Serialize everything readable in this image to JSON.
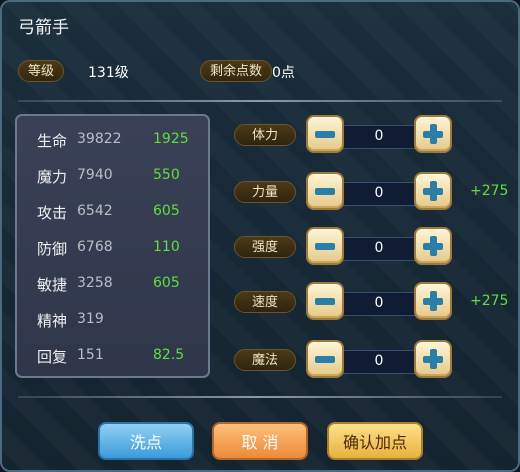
{
  "title": "弓箭手",
  "level": {
    "label": "等级",
    "value": "131级"
  },
  "points": {
    "label": "剩余点数",
    "value": "0点"
  },
  "stats": [
    {
      "name": "生命",
      "value": "39822",
      "bonus": "1925"
    },
    {
      "name": "魔力",
      "value": "7940",
      "bonus": "550"
    },
    {
      "name": "攻击",
      "value": "6542",
      "bonus": "605"
    },
    {
      "name": "防御",
      "value": "6768",
      "bonus": "110"
    },
    {
      "name": "敏捷",
      "value": "3258",
      "bonus": "605"
    },
    {
      "name": "精神",
      "value": "319",
      "bonus": ""
    },
    {
      "name": "回复",
      "value": "151",
      "bonus": "82.5"
    }
  ],
  "allocations": [
    {
      "label": "体力",
      "value": "0",
      "extra": ""
    },
    {
      "label": "力量",
      "value": "0",
      "extra": "+275"
    },
    {
      "label": "强度",
      "value": "0",
      "extra": ""
    },
    {
      "label": "速度",
      "value": "0",
      "extra": "+275"
    },
    {
      "label": "魔法",
      "value": "0",
      "extra": ""
    }
  ],
  "buttons": {
    "reset": "洗点",
    "cancel": "取 消",
    "confirm": "确认加点"
  },
  "colors": {
    "bonus": "#5fe03a",
    "accent_blue": "#3c9bdb",
    "accent_orange": "#ec8a3a",
    "accent_gold": "#e7b23d"
  }
}
